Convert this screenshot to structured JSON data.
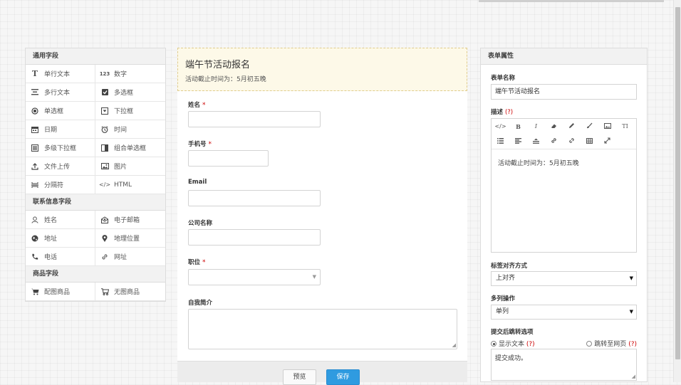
{
  "palette": {
    "sections": [
      {
        "title": "通用字段",
        "items": [
          {
            "label": "单行文本",
            "icon": "text-t-icon"
          },
          {
            "label": "数字",
            "icon": "number-123-icon"
          },
          {
            "label": "多行文本",
            "icon": "paragraph-icon"
          },
          {
            "label": "多选框",
            "icon": "checkbox-icon"
          },
          {
            "label": "单选框",
            "icon": "radio-icon"
          },
          {
            "label": "下拉框",
            "icon": "dropdown-icon"
          },
          {
            "label": "日期",
            "icon": "calendar-icon"
          },
          {
            "label": "时间",
            "icon": "alarm-clock-icon"
          },
          {
            "label": "多级下拉框",
            "icon": "multilevel-list-icon"
          },
          {
            "label": "组合单选框",
            "icon": "combo-radio-icon"
          },
          {
            "label": "文件上传",
            "icon": "upload-icon"
          },
          {
            "label": "图片",
            "icon": "image-icon"
          },
          {
            "label": "分隔符",
            "icon": "separator-icon"
          },
          {
            "label": "HTML",
            "icon": "code-icon"
          }
        ]
      },
      {
        "title": "联系信息字段",
        "items": [
          {
            "label": "姓名",
            "icon": "user-icon"
          },
          {
            "label": "电子邮箱",
            "icon": "mail-icon"
          },
          {
            "label": "地址",
            "icon": "globe-icon"
          },
          {
            "label": "地理位置",
            "icon": "map-pin-icon"
          },
          {
            "label": "电话",
            "icon": "phone-icon"
          },
          {
            "label": "网址",
            "icon": "link-icon"
          }
        ]
      },
      {
        "title": "商品字段",
        "items": [
          {
            "label": "配图商品",
            "icon": "cart-filled-icon"
          },
          {
            "label": "无图商品",
            "icon": "cart-outline-icon"
          }
        ]
      }
    ]
  },
  "form": {
    "title": "端午节活动报名",
    "subtitle": "活动截止时间为：5月初五晚",
    "required_mark": "*",
    "fields": [
      {
        "label": "姓名",
        "required": true
      },
      {
        "label": "手机号",
        "required": true
      },
      {
        "label": "Email",
        "required": false
      },
      {
        "label": "公司名称",
        "required": false
      },
      {
        "label": "职位",
        "required": true
      },
      {
        "label": "自我简介",
        "required": false
      }
    ],
    "preview_label": "预览",
    "save_label": "保存"
  },
  "props": {
    "header": "表单属性",
    "name_label": "表单名称",
    "name_value": "端午节活动报名",
    "desc_label": "描述",
    "help_mark": "(?)",
    "toolbar_row1": [
      "</>",
      "B",
      "I",
      "eraser",
      "pencil",
      "brush",
      "image",
      "TI"
    ],
    "toolbar_row2": [
      "list",
      "align",
      "hr",
      "link",
      "unlink",
      "table",
      "fullscreen"
    ],
    "desc_value": "活动截止时间为：5月初五晚",
    "align_label": "标签对齐方式",
    "align_value": "上对齐",
    "multicol_label": "多列操作",
    "multicol_value": "单列",
    "redirect_label": "提交后跳转选项",
    "radio_text_label": "显示文本",
    "radio_url_label": "跳转至网页",
    "radio_selected": "显示文本",
    "success_text": "提交成功。"
  }
}
